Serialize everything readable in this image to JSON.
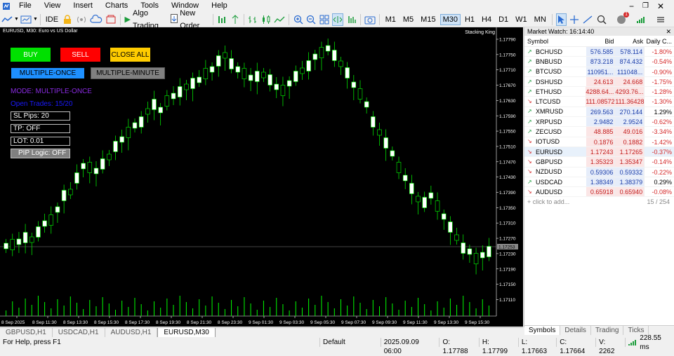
{
  "menubar": {
    "items": [
      "File",
      "View",
      "Insert",
      "Charts",
      "Tools",
      "Window",
      "Help"
    ]
  },
  "toolbar": {
    "ide": "IDE",
    "algo_trading": "Algo Trading",
    "new_order": "New Order",
    "timeframes": [
      "M1",
      "M5",
      "M15",
      "M30",
      "H1",
      "H4",
      "D1",
      "W1",
      "MN"
    ],
    "active_timeframe": "M30",
    "notification_count": "1"
  },
  "chart": {
    "title": "EURUSD, M30:  Euro vs US Dollar",
    "corner_label": "Stacking King",
    "current_price": "1.17253",
    "price_labels": [
      "1.17790",
      "1.17750",
      "1.17710",
      "1.17670",
      "1.17630",
      "1.17590",
      "1.17550",
      "1.17510",
      "1.17470",
      "1.17430",
      "1.17390",
      "1.17350",
      "1.17310",
      "1.17270",
      "1.17230",
      "1.17190",
      "1.17150",
      "1.17110"
    ],
    "time_labels": [
      "8 Sep 2025",
      "8 Sep 11:30",
      "8 Sep 13:30",
      "8 Sep 15:30",
      "8 Sep 17:30",
      "8 Sep 19:30",
      "8 Sep 21:30",
      "8 Sep 23:30",
      "9 Sep 01:30",
      "9 Sep 03:30",
      "9 Sep 05:30",
      "9 Sep 07:30",
      "9 Sep 09:30",
      "9 Sep 11:30",
      "9 Sep 13:30",
      "9 Sep 15:30"
    ],
    "colors": {
      "bull_fill": "#000000",
      "bear_fill": "#ffffff",
      "wick": "#00ff00",
      "volume": "#00ff00"
    }
  },
  "ea_panel": {
    "buy": "BUY",
    "sell": "SELL",
    "close_all": "CLOSE ALL",
    "multiple_once": "MULTIPLE-ONCE",
    "multiple_minute": "MULTIPLE-MINUTE",
    "mode": "MODE: MULTIPLE-ONCE",
    "open_trades": "Open Trades: 15/20",
    "sl_pips": "SL Pips: 20",
    "tp": "TP: OFF",
    "lot": "LOT: 0.01",
    "pip_logic": "PIP Logic: OFF",
    "colors": {
      "buy": "#00e000",
      "sell": "#ff0000",
      "close_all": "#ffcc00",
      "multiple_once": "#1e90ff",
      "multiple_minute": "#808080",
      "mode": "#8a2be2",
      "open_trades": "#1a1aff"
    }
  },
  "chart_tabs": [
    "GBPUSD,H1",
    "USDCAD,H1",
    "AUDUSD,H1",
    "EURUSD,M30"
  ],
  "active_chart_tab": "EURUSD,M30",
  "status": {
    "help": "For Help, press F1",
    "profile": "Default",
    "datetime": "2025.09.09 06:00",
    "open": "O: 1.17788",
    "high": "H: 1.17799",
    "low": "L: 1.17663",
    "close": "C: 1.17664",
    "volume": "V: 2262",
    "speed": "228.55 ms"
  },
  "market_watch": {
    "title": "Market Watch: 16:14:40",
    "headers": {
      "symbol": "Symbol",
      "bid": "Bid",
      "ask": "Ask",
      "change": "Daily C..."
    },
    "rows": [
      {
        "symbol": "BCHUSD",
        "bid": "576.585",
        "ask": "578.114",
        "change": "-1.80%",
        "dir": "up",
        "tone": "blue"
      },
      {
        "symbol": "BNBUSD",
        "bid": "873.218",
        "ask": "874.432",
        "change": "-0.54%",
        "dir": "up",
        "tone": "blue"
      },
      {
        "symbol": "BTCUSD",
        "bid": "110951...",
        "ask": "111048...",
        "change": "-0.90%",
        "dir": "up",
        "tone": "blue"
      },
      {
        "symbol": "DSHUSD",
        "bid": "24.613",
        "ask": "24.668",
        "change": "-1.75%",
        "dir": "up",
        "tone": "red"
      },
      {
        "symbol": "ETHUSD",
        "bid": "4288.64...",
        "ask": "4293.76...",
        "change": "-1.28%",
        "dir": "up",
        "tone": "red"
      },
      {
        "symbol": "LTCUSD",
        "bid": "111.08572",
        "ask": "111.36428",
        "change": "-1.30%",
        "dir": "down",
        "tone": "red"
      },
      {
        "symbol": "XMRUSD",
        "bid": "269.563",
        "ask": "270.144",
        "change": "1.29%",
        "dir": "up",
        "tone": "blue"
      },
      {
        "symbol": "XRPUSD",
        "bid": "2.9482",
        "ask": "2.9524",
        "change": "-0.62%",
        "dir": "up",
        "tone": "blue"
      },
      {
        "symbol": "ZECUSD",
        "bid": "48.885",
        "ask": "49.016",
        "change": "-3.34%",
        "dir": "up",
        "tone": "red"
      },
      {
        "symbol": "IOTUSD",
        "bid": "0.1876",
        "ask": "0.1882",
        "change": "-1.42%",
        "dir": "down",
        "tone": "red"
      },
      {
        "symbol": "EURUSD",
        "bid": "1.17243",
        "ask": "1.17265",
        "change": "-0.37%",
        "dir": "down",
        "tone": "red"
      },
      {
        "symbol": "GBPUSD",
        "bid": "1.35323",
        "ask": "1.35347",
        "change": "-0.14%",
        "dir": "down",
        "tone": "red"
      },
      {
        "symbol": "NZDUSD",
        "bid": "0.59306",
        "ask": "0.59332",
        "change": "-0.22%",
        "dir": "down",
        "tone": "blue"
      },
      {
        "symbol": "USDCAD",
        "bid": "1.38349",
        "ask": "1.38379",
        "change": "0.29%",
        "dir": "up",
        "tone": "blue"
      },
      {
        "symbol": "AUDUSD",
        "bid": "0.65918",
        "ask": "0.65940",
        "change": "-0.08%",
        "dir": "down",
        "tone": "red"
      }
    ],
    "add_placeholder": "click to add...",
    "count": "15 / 254",
    "tabs": [
      "Symbols",
      "Details",
      "Trading",
      "Ticks"
    ],
    "active_tab": "Symbols"
  }
}
